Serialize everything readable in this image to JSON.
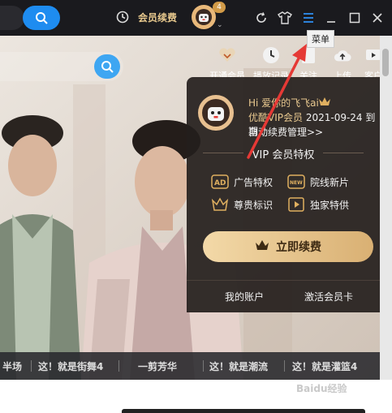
{
  "titlebar": {
    "renew_label": "会员续费",
    "avatar_badge": "4",
    "tooltip": "菜单"
  },
  "toolbar": {
    "items": [
      {
        "label": "开通会员",
        "icon": "heart-badge-icon"
      },
      {
        "label": "播放记录",
        "icon": "clock-icon"
      },
      {
        "label": "关注",
        "icon": "bookmark-icon"
      },
      {
        "label": "上传",
        "icon": "cloud-upload-icon"
      },
      {
        "label": "客户",
        "icon": "client-icon"
      }
    ]
  },
  "vip_panel": {
    "greeting": "Hi 爱你的飞飞ai",
    "expire_prefix": "优酷VIP会员",
    "expire_date": "2021-09-24 到期",
    "auto_renew": "自动续费管理>>",
    "section_title": "VIP 会员特权",
    "perks": [
      {
        "label": "广告特权",
        "icon": "ad-icon"
      },
      {
        "label": "院线新片",
        "icon": "new-icon"
      },
      {
        "label": "尊贵标识",
        "icon": "crown-icon"
      },
      {
        "label": "独家特供",
        "icon": "film-icon"
      }
    ],
    "renew_button": "立即续费",
    "account_link": "我的账户",
    "activate_link": "激活会员卡"
  },
  "category_strip": {
    "items": [
      "半场",
      "这！就是街舞4",
      "一剪芳华",
      "这！就是潮流",
      "这！就是灌篮4"
    ]
  },
  "watermark": "Baidu经验",
  "colors": {
    "accent_blue": "#1e8cf0",
    "vip_gold": "#e8c88f",
    "arrow_red": "#e53935"
  }
}
